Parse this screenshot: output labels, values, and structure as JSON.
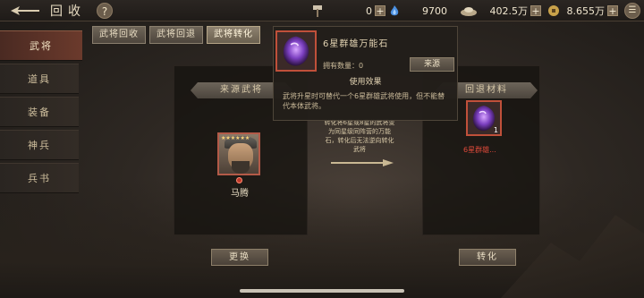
{
  "header": {
    "title": "回收",
    "help": "?",
    "resources": [
      {
        "icon": "hammer-icon",
        "value": "0"
      },
      {
        "icon": "spirit-flame-icon",
        "value": "9700"
      },
      {
        "icon": "silver-ingot-icon",
        "value": "402.5万"
      },
      {
        "icon": "copper-coin-icon",
        "value": "8.655万"
      }
    ],
    "menu": "☰"
  },
  "sidebar": {
    "items": [
      {
        "label": "武将",
        "active": true
      },
      {
        "label": "道具",
        "active": false
      },
      {
        "label": "装备",
        "active": false
      },
      {
        "label": "神兵",
        "active": false
      },
      {
        "label": "兵书",
        "active": false
      }
    ]
  },
  "subtabs": [
    {
      "label": "武将回收",
      "active": false
    },
    {
      "label": "武将回退",
      "active": false
    },
    {
      "label": "武将转化",
      "active": true
    }
  ],
  "left_panel": {
    "header": "来源武将",
    "hero": {
      "name": "马腾",
      "stars": "★★★★★★"
    },
    "button": "更换"
  },
  "middle": {
    "text": "转化将6星或8星的武将变为同星级同阵营的万能石，转化后无法逆向转化武将"
  },
  "right_panel": {
    "header": "回退材料",
    "item": {
      "count": "1",
      "name": "6星群雄..."
    },
    "button": "转化"
  },
  "tooltip": {
    "title": "6星群雄万能石",
    "owned": "拥有数量：0",
    "source_button": "来源",
    "effect_header": "使用效果",
    "description": "武将升星时可替代一个6星群雄武将使用，但不能替代本体武将。"
  },
  "colors": {
    "active_tab": "#6b3a2c",
    "item_border": "#c0503a",
    "item_name": "#e04a3a"
  }
}
